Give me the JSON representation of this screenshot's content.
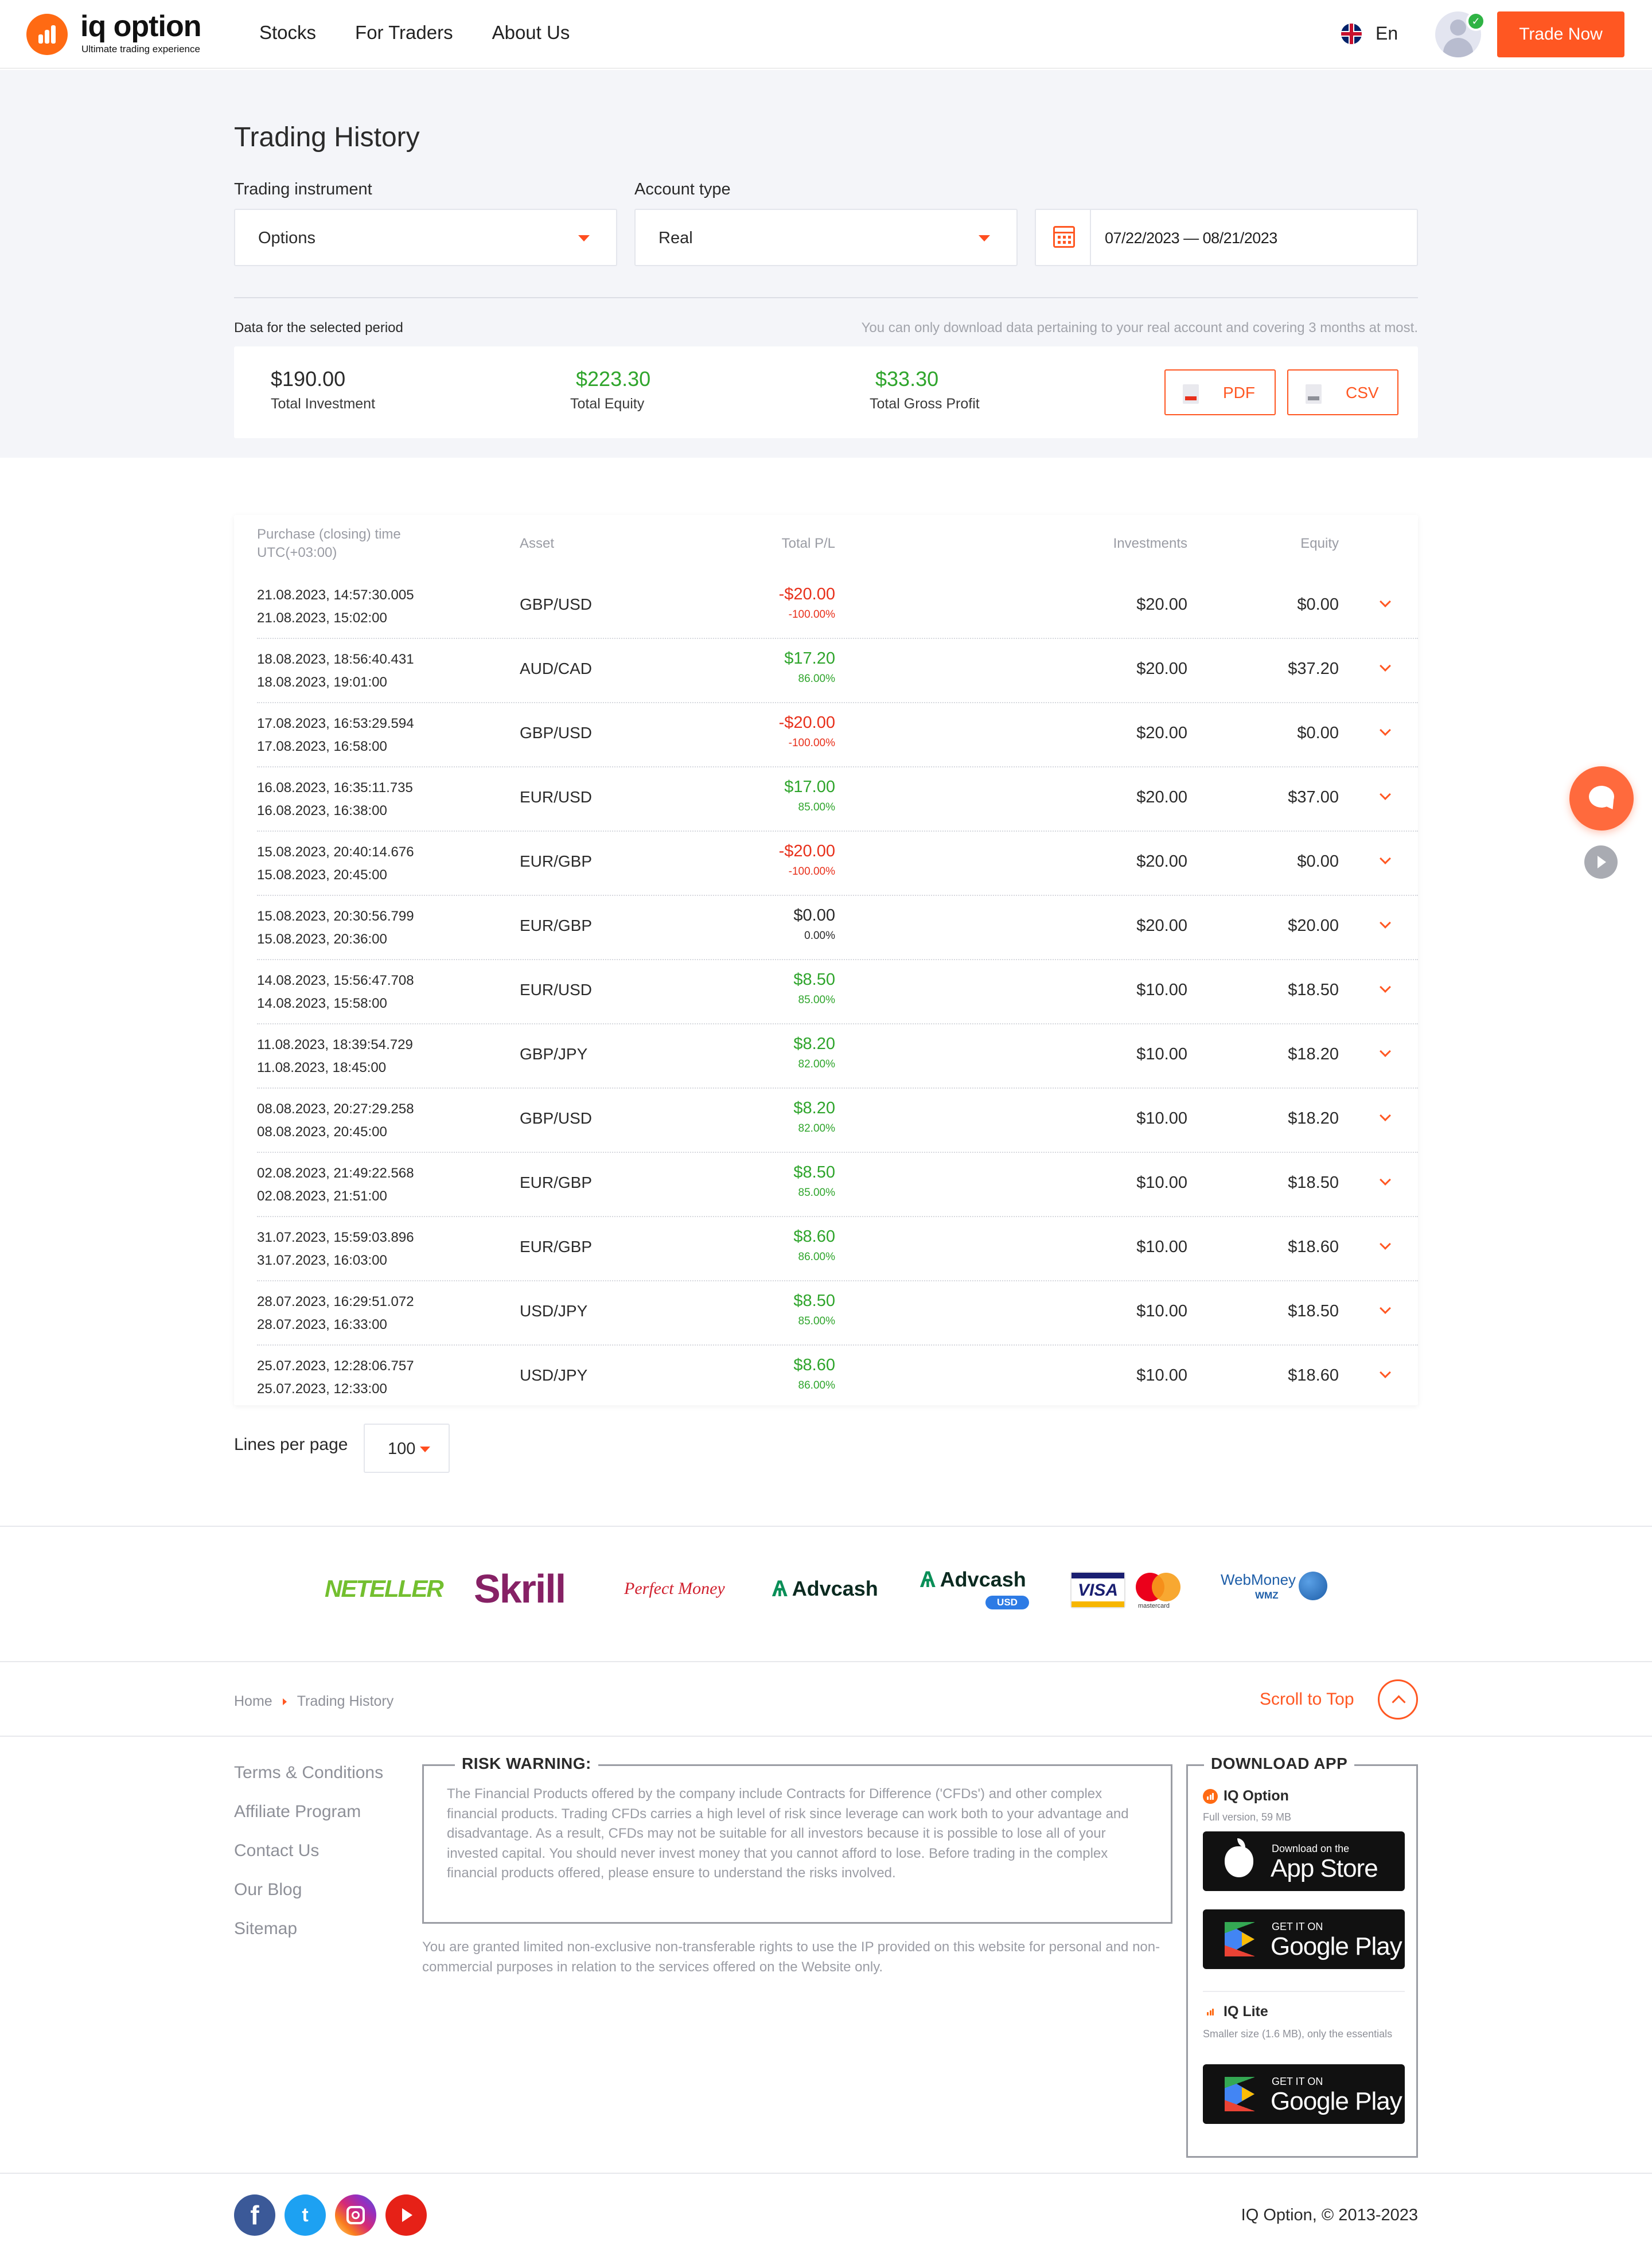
{
  "header": {
    "logo_name": "iq option",
    "logo_tagline": "Ultimate trading experience",
    "nav": [
      "Stocks",
      "For Traders",
      "About Us"
    ],
    "language": "En",
    "trade_button": "Trade Now"
  },
  "page": {
    "title": "Trading History"
  },
  "filters": {
    "instrument_label": "Trading instrument",
    "instrument_value": "Options",
    "account_label": "Account type",
    "account_value": "Real",
    "date_range": "07/22/2023 — 08/21/2023"
  },
  "summary": {
    "period_label": "Data for the selected period",
    "note": "You can only download data pertaining to your real account and covering 3 months at most.",
    "total_investment": "$190.00",
    "total_investment_label": "Total Investment",
    "total_equity": "$223.30",
    "total_equity_label": "Total Equity",
    "total_gross_profit": "$33.30",
    "total_gross_profit_label": "Total Gross Profit",
    "pdf_label": "PDF",
    "csv_label": "CSV"
  },
  "table": {
    "headers": {
      "time_line1": "Purchase (closing) time",
      "time_line2": "UTC(+03:00)",
      "asset": "Asset",
      "investments": "Investments",
      "pl": "Total P/L",
      "equity": "Equity"
    },
    "rows": [
      {
        "open": "21.08.2023, 14:57:30.005",
        "close": "21.08.2023, 15:02:00",
        "asset": "GBP/USD",
        "inv": "$20.00",
        "pl": "-$20.00",
        "pct": "-100.00%",
        "sign": "neg",
        "equity": "$0.00"
      },
      {
        "open": "18.08.2023, 18:56:40.431",
        "close": "18.08.2023, 19:01:00",
        "asset": "AUD/CAD",
        "inv": "$20.00",
        "pl": "$17.20",
        "pct": "86.00%",
        "sign": "pos",
        "equity": "$37.20"
      },
      {
        "open": "17.08.2023, 16:53:29.594",
        "close": "17.08.2023, 16:58:00",
        "asset": "GBP/USD",
        "inv": "$20.00",
        "pl": "-$20.00",
        "pct": "-100.00%",
        "sign": "neg",
        "equity": "$0.00"
      },
      {
        "open": "16.08.2023, 16:35:11.735",
        "close": "16.08.2023, 16:38:00",
        "asset": "EUR/USD",
        "inv": "$20.00",
        "pl": "$17.00",
        "pct": "85.00%",
        "sign": "pos",
        "equity": "$37.00"
      },
      {
        "open": "15.08.2023, 20:40:14.676",
        "close": "15.08.2023, 20:45:00",
        "asset": "EUR/GBP",
        "inv": "$20.00",
        "pl": "-$20.00",
        "pct": "-100.00%",
        "sign": "neg",
        "equity": "$0.00"
      },
      {
        "open": "15.08.2023, 20:30:56.799",
        "close": "15.08.2023, 20:36:00",
        "asset": "EUR/GBP",
        "inv": "$20.00",
        "pl": "$0.00",
        "pct": "0.00%",
        "sign": "neu",
        "equity": "$20.00"
      },
      {
        "open": "14.08.2023, 15:56:47.708",
        "close": "14.08.2023, 15:58:00",
        "asset": "EUR/USD",
        "inv": "$10.00",
        "pl": "$8.50",
        "pct": "85.00%",
        "sign": "pos",
        "equity": "$18.50"
      },
      {
        "open": "11.08.2023, 18:39:54.729",
        "close": "11.08.2023, 18:45:00",
        "asset": "GBP/JPY",
        "inv": "$10.00",
        "pl": "$8.20",
        "pct": "82.00%",
        "sign": "pos",
        "equity": "$18.20"
      },
      {
        "open": "08.08.2023, 20:27:29.258",
        "close": "08.08.2023, 20:45:00",
        "asset": "GBP/USD",
        "inv": "$10.00",
        "pl": "$8.20",
        "pct": "82.00%",
        "sign": "pos",
        "equity": "$18.20"
      },
      {
        "open": "02.08.2023, 21:49:22.568",
        "close": "02.08.2023, 21:51:00",
        "asset": "EUR/GBP",
        "inv": "$10.00",
        "pl": "$8.50",
        "pct": "85.00%",
        "sign": "pos",
        "equity": "$18.50"
      },
      {
        "open": "31.07.2023, 15:59:03.896",
        "close": "31.07.2023, 16:03:00",
        "asset": "EUR/GBP",
        "inv": "$10.00",
        "pl": "$8.60",
        "pct": "86.00%",
        "sign": "pos",
        "equity": "$18.60"
      },
      {
        "open": "28.07.2023, 16:29:51.072",
        "close": "28.07.2023, 16:33:00",
        "asset": "USD/JPY",
        "inv": "$10.00",
        "pl": "$8.50",
        "pct": "85.00%",
        "sign": "pos",
        "equity": "$18.50"
      },
      {
        "open": "25.07.2023, 12:28:06.757",
        "close": "25.07.2023, 12:33:00",
        "asset": "USD/JPY",
        "inv": "$10.00",
        "pl": "$8.60",
        "pct": "86.00%",
        "sign": "pos",
        "equity": "$18.60"
      }
    ]
  },
  "pagination": {
    "lines_label": "Lines per page",
    "lines_value": "100"
  },
  "payments": {
    "neteller": "NETELLER",
    "skrill": "Skrill",
    "perfect_money": "Perfect Money",
    "advcash": "Advcash",
    "advcash_usd": "Advcash",
    "usd_badge": "USD",
    "visa": "VISA",
    "mastercard": "mastercard",
    "webmoney": "WebMoney",
    "wmz": "WMZ"
  },
  "breadcrumb": {
    "home": "Home",
    "current": "Trading History",
    "scroll_top": "Scroll to Top"
  },
  "footer": {
    "links": [
      "Terms & Conditions",
      "Affiliate Program",
      "Contact Us",
      "Our Blog",
      "Sitemap"
    ],
    "risk_title": "RISK WARNING:",
    "risk_text": "The Financial Products offered by the company include Contracts for Difference ('CFDs') and other complex financial products. Trading CFDs carries a high level of risk since leverage can work both to your advantage and disadvantage. As a result, CFDs may not be suitable for all investors because it is possible to lose all of your invested capital. You should never invest money that you cannot afford to lose. Before trading in the complex financial products offered, please ensure to understand the risks involved.",
    "ip_text": "You are granted limited non-exclusive non-transferable rights to use the IP provided on this website for personal and non-commercial purposes in relation to the services offered on the Website only.",
    "download_title": "DOWNLOAD APP",
    "app1_name": "IQ Option",
    "app1_sub": "Full version, 59 MB",
    "appstore_small": "Download on the",
    "appstore_big": "App Store",
    "gplay_small": "GET IT ON",
    "gplay_big": "Google Play",
    "app2_name": "IQ Lite",
    "app2_sub": "Smaller size (1.6 MB), only the essentials",
    "social": [
      "f",
      "t"
    ],
    "copyright": "IQ Option, © 2013-2023"
  }
}
